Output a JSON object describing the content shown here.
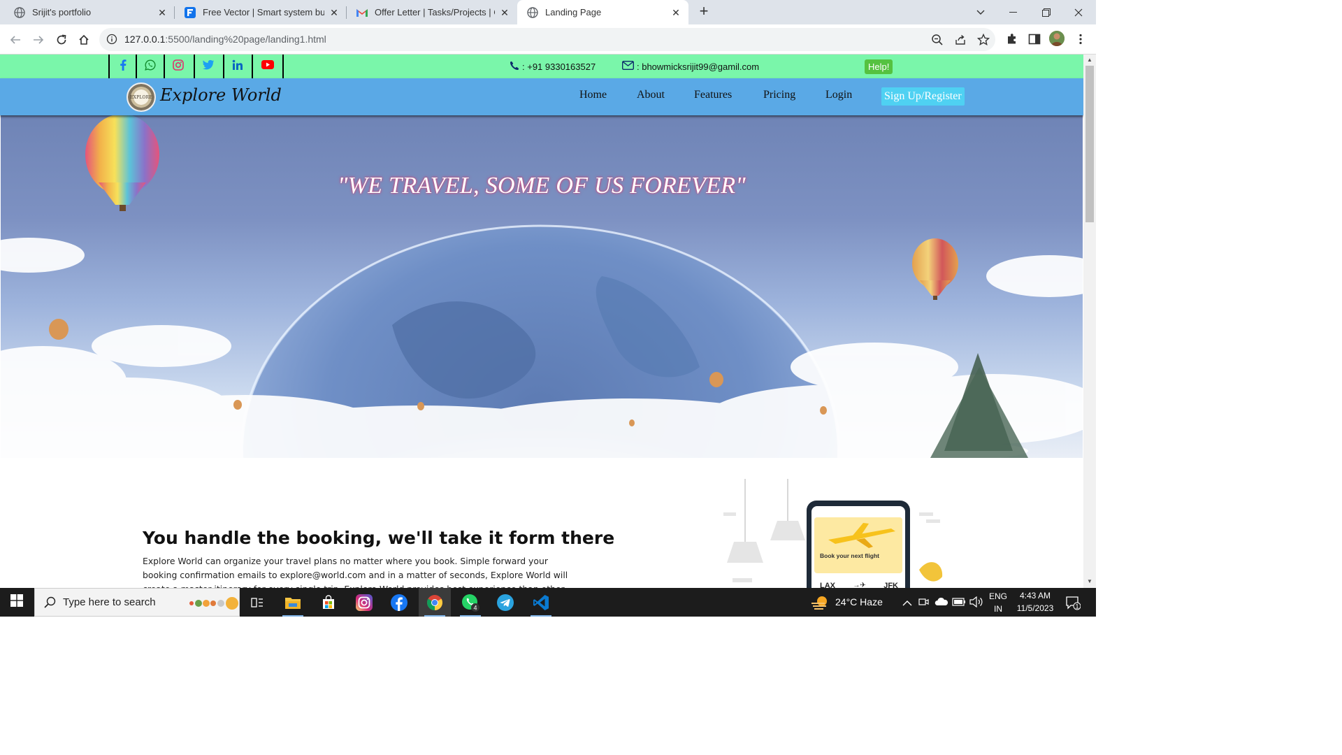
{
  "browser": {
    "tabs": [
      {
        "title": "Srijit's portfolio",
        "icon": "globe-icon"
      },
      {
        "title": "Free Vector | Smart system busi",
        "icon": "freepik-icon"
      },
      {
        "title": "Offer Letter | Tasks/Projects | Co",
        "icon": "gmail-icon"
      },
      {
        "title": "Landing Page",
        "icon": "globe-icon",
        "active": true
      }
    ],
    "url_host": "127.0.0.1",
    "url_rest": ":5500/landing%20page/landing1.html"
  },
  "topbar": {
    "social_icons": [
      "facebook-icon",
      "whatsapp-icon",
      "instagram-icon",
      "twitter-icon",
      "linkedin-icon",
      "youtube-icon"
    ],
    "phone": ": +91 9330163527",
    "email": ": bhowmicksrijit99@gamil.com",
    "help_label": "Help!"
  },
  "navbar": {
    "logo_text": "EXPLORE",
    "brand": "Explore World",
    "menu": [
      "Home",
      "About",
      "Features",
      "Pricing",
      "Login"
    ],
    "signup_label": "Sign Up/Register"
  },
  "hero": {
    "quote": "\"WE TRAVEL, SOME OF US FOREVER\""
  },
  "section2": {
    "title": "You handle the booking, we'll take it form there",
    "body": "Explore World can organize your travel plans no matter where you book. Simple forward your booking confirmation emails to explore@world.com and in a matter of seconds, Explore World will create a master itinerary for every single trip. Explore World provides best experience than other travel apps.",
    "phone_card_text": "Book your next flight",
    "from_code": "LAX",
    "to_code": "JFK"
  },
  "taskbar": {
    "search_placeholder": "Type here to search",
    "whatsapp_badge": "4",
    "weather": "24°C  Haze",
    "lang_top": "ENG",
    "lang_bottom": "IN",
    "time": "4:43 AM",
    "date": "11/5/2023",
    "notification_count": "1"
  },
  "colors": {
    "topbar_bg": "#7af6aa",
    "navbar_bg": "#5aa9e6",
    "signup_bg": "#4fd1f2",
    "help_bg": "#55c240",
    "quote_glow": "#d1467a"
  }
}
